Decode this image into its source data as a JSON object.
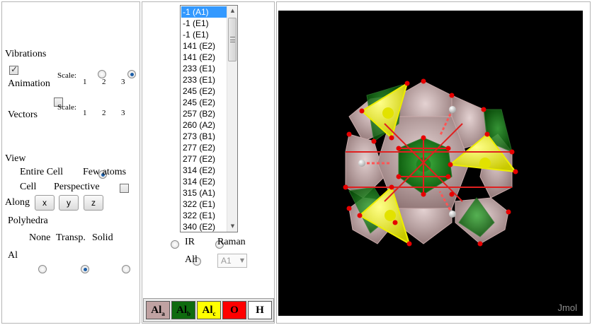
{
  "left": {
    "vibrations_heading": "Vibrations",
    "animation_label": "Animation",
    "vectors_label": "Vectors",
    "scale_label": "Scale:",
    "scale_options": [
      "1",
      "2",
      "3"
    ],
    "view_heading": "View",
    "entire_cell_label": "Entire Cell",
    "few_atoms_label": "Few atoms",
    "cell_label": "Cell",
    "perspective_label": "Perspective",
    "along_label": "Along",
    "axis_buttons": [
      "x",
      "y",
      "z"
    ],
    "polyhedra_heading": "Polyhedra",
    "poly_options": [
      "None",
      "Transp.",
      "Solid"
    ],
    "poly_row_label": "Al"
  },
  "middle": {
    "modes": [
      "-1 (A1)",
      "-1 (E1)",
      "-1 (E1)",
      "141 (E2)",
      "141 (E2)",
      "233 (E1)",
      "233 (E1)",
      "245 (E2)",
      "245 (E2)",
      "257 (B2)",
      "260 (A2)",
      "273 (B1)",
      "277 (E2)",
      "277 (E2)",
      "314 (E2)",
      "314 (E2)",
      "315 (A1)",
      "322 (E1)",
      "322 (E1)",
      "340 (E2)"
    ],
    "ir_label": "IR",
    "raman_label": "Raman",
    "all_label": "All",
    "symmetry_select_value": "A1",
    "legend": [
      {
        "main": "Al",
        "sub": "a",
        "color": "#c0a2a2",
        "text_color": "#000000"
      },
      {
        "main": "Al",
        "sub": "b",
        "color": "#0f6b0f",
        "text_color": "#000000"
      },
      {
        "main": "Al",
        "sub": "c",
        "color": "#ffff00",
        "text_color": "#000000"
      },
      {
        "main": "O",
        "sub": "",
        "color": "#ff0000",
        "text_color": "#000000"
      },
      {
        "main": "H",
        "sub": "",
        "color": "#ffffff",
        "text_color": "#000000"
      }
    ]
  },
  "viewer": {
    "watermark": "Jmol",
    "background": "#000000"
  }
}
